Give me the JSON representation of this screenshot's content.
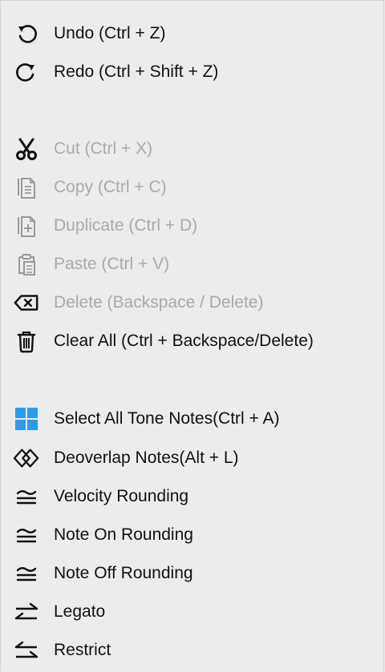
{
  "menu": {
    "items": [
      {
        "label": "Undo (Ctrl + Z)"
      },
      {
        "label": "Redo (Ctrl + Shift + Z)"
      },
      {
        "label": "Cut (Ctrl + X)"
      },
      {
        "label": "Copy (Ctrl + C)"
      },
      {
        "label": "Duplicate (Ctrl + D)"
      },
      {
        "label": "Paste (Ctrl + V)"
      },
      {
        "label": "Delete (Backspace / Delete)"
      },
      {
        "label": "Clear All (Ctrl + Backspace/Delete)"
      },
      {
        "label": "Select All Tone Notes(Ctrl + A)"
      },
      {
        "label": "Deoverlap Notes(Alt + L)"
      },
      {
        "label": "Velocity Rounding"
      },
      {
        "label": "Note On Rounding"
      },
      {
        "label": "Note Off Rounding"
      },
      {
        "label": "Legato"
      },
      {
        "label": "Restrict"
      }
    ]
  },
  "colors": {
    "background": "#ececec",
    "text": "#111111",
    "disabled_text": "#aaaaaa",
    "accent": "#2e9be6"
  }
}
